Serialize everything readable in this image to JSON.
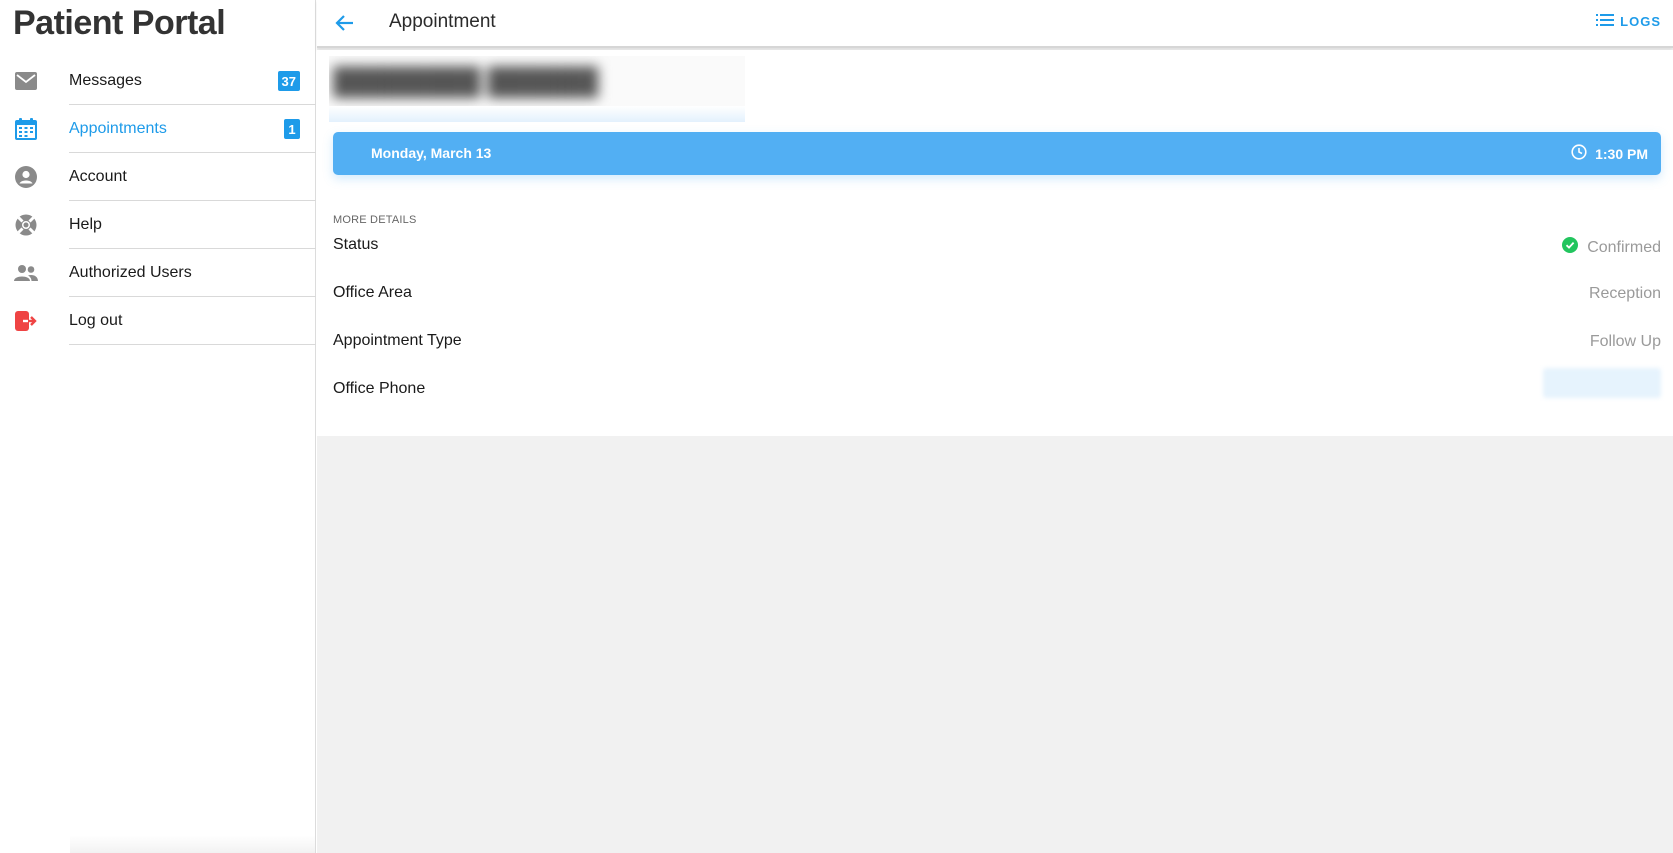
{
  "sidebar": {
    "brand": "Patient Portal",
    "items": [
      {
        "label": "Messages",
        "badge": "37",
        "icon": "envelope-icon"
      },
      {
        "label": "Appointments",
        "badge": "1",
        "icon": "calendar-icon",
        "active": true
      },
      {
        "label": "Account",
        "icon": "account-circle-icon"
      },
      {
        "label": "Help",
        "icon": "lifebuoy-icon"
      },
      {
        "label": "Authorized Users",
        "icon": "people-icon"
      },
      {
        "label": "Log out",
        "icon": "logout-icon"
      }
    ]
  },
  "header": {
    "title": "Appointment",
    "logs_label": "LOGS"
  },
  "appointment": {
    "date": "Monday, March 13",
    "time": "1:30 PM"
  },
  "details": {
    "section_label": "MORE DETAILS",
    "rows": [
      {
        "key": "Status",
        "value": "Confirmed"
      },
      {
        "key": "Office Area",
        "value": "Reception"
      },
      {
        "key": "Appointment Type",
        "value": "Follow Up"
      },
      {
        "key": "Office Phone",
        "value": ""
      }
    ]
  },
  "colors": {
    "accent": "#1e9be9",
    "date_bar": "#52aff3",
    "confirmed_green": "#22c55e",
    "logout_red": "#ef4444",
    "icon_gray": "#8a8a8a"
  }
}
